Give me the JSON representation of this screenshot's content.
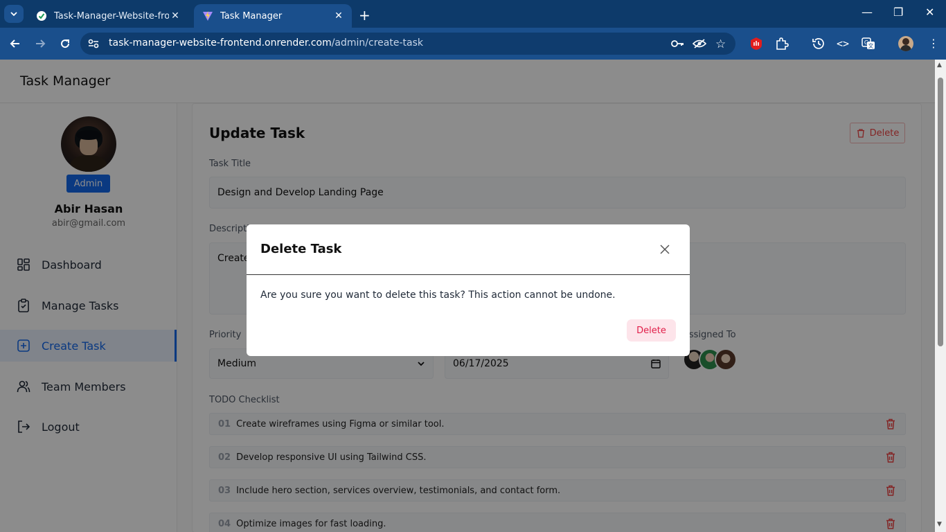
{
  "browser": {
    "tabs": [
      {
        "title": "Task-Manager-Website-frontend",
        "icon": "green-check-icon"
      },
      {
        "title": "Task Manager",
        "icon": "vite-logo-icon"
      }
    ],
    "url_host": "task-manager-website-frontend.onrender.com",
    "url_path": "/admin/create-task"
  },
  "app": {
    "title": "Task Manager"
  },
  "user": {
    "role": "Admin",
    "name": "Abir Hasan",
    "email": "abir@gmail.com"
  },
  "nav": [
    {
      "label": "Dashboard",
      "icon": "dashboard-icon"
    },
    {
      "label": "Manage Tasks",
      "icon": "clipboard-check-icon"
    },
    {
      "label": "Create Task",
      "icon": "plus-square-icon"
    },
    {
      "label": "Team Members",
      "icon": "users-icon"
    },
    {
      "label": "Logout",
      "icon": "logout-icon"
    }
  ],
  "form": {
    "page_title": "Update Task",
    "delete_label": "Delete",
    "task_title_label": "Task Title",
    "task_title_value": "Design and Develop Landing Page",
    "description_label": "Description",
    "description_value": "Create a modern, responsive landing page with hero section, services overview, testimonials.",
    "priority_label": "Priority",
    "priority_value": "Medium",
    "due_date_value": "06/17/2025",
    "assigned_label": "Assigned To",
    "checklist_label": "TODO Checklist",
    "checklist": [
      {
        "num": "01",
        "text": "Create wireframes using Figma or similar tool."
      },
      {
        "num": "02",
        "text": "Develop responsive UI using Tailwind CSS."
      },
      {
        "num": "03",
        "text": "Include hero section, services overview, testimonials, and contact form."
      },
      {
        "num": "04",
        "text": "Optimize images for fast loading."
      }
    ]
  },
  "modal": {
    "title": "Delete Task",
    "message": "Are you sure you want to delete this task? This action cannot be undone.",
    "confirm_label": "Delete"
  },
  "colors": {
    "primary": "#1368ec",
    "danger": "#ef4444",
    "browser_toolbar": "#1a4f8c"
  }
}
